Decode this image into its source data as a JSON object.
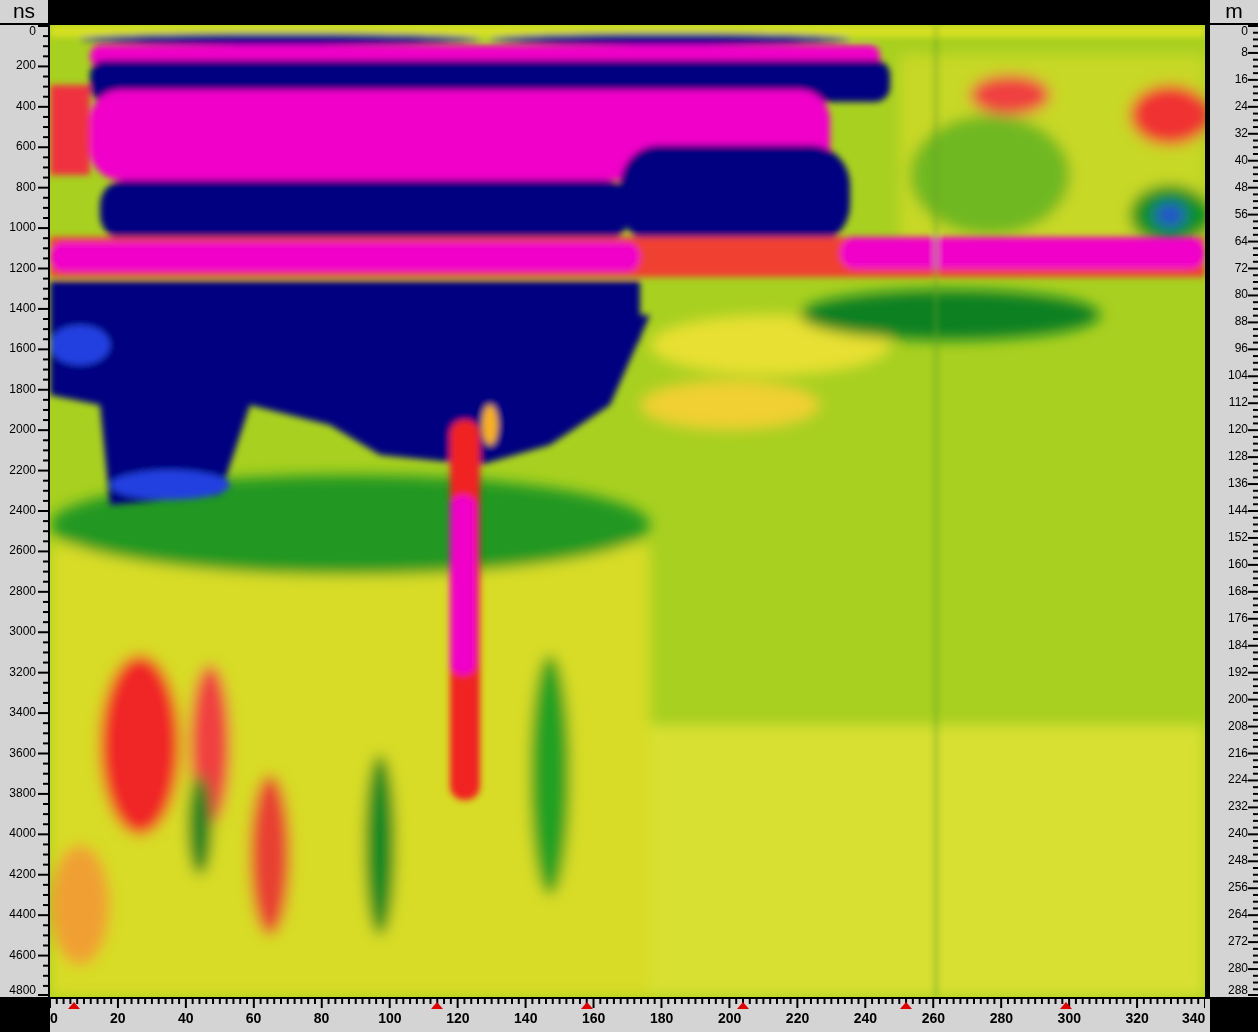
{
  "left_axis": {
    "unit": "ns",
    "labels": [
      "0",
      "200",
      "400",
      "600",
      "800",
      "1000",
      "1200",
      "1400",
      "1600",
      "1800",
      "2000",
      "2200",
      "2400",
      "2600",
      "2800",
      "3000",
      "3200",
      "3400",
      "3600",
      "3800",
      "4000",
      "4200",
      "4400",
      "4600",
      "4800"
    ]
  },
  "right_axis": {
    "unit": "m",
    "labels": [
      "0",
      "8",
      "16",
      "24",
      "32",
      "40",
      "48",
      "56",
      "64",
      "72",
      "80",
      "88",
      "96",
      "104",
      "112",
      "120",
      "128",
      "136",
      "144",
      "152",
      "160",
      "168",
      "176",
      "184",
      "192",
      "200",
      "208",
      "216",
      "224",
      "232",
      "240",
      "248",
      "256",
      "264",
      "272",
      "280",
      "288"
    ]
  },
  "bottom_axis": {
    "labels": [
      "0",
      "20",
      "40",
      "60",
      "80",
      "100",
      "120",
      "140",
      "160",
      "180",
      "200",
      "220",
      "240",
      "260",
      "280",
      "300",
      "320",
      "340"
    ]
  }
}
